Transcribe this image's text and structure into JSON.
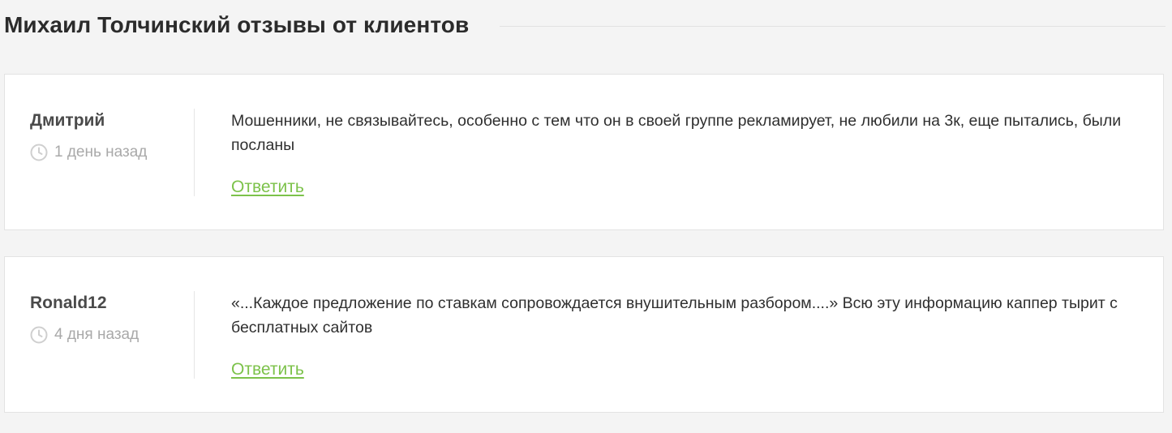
{
  "page": {
    "title": "Михаил Толчинский отзывы от клиентов"
  },
  "reviews": [
    {
      "author": "Дмитрий",
      "date": "1 день назад",
      "text": "Мошенники, не связывайтесь, особенно с тем что он в своей группе рекламирует, не любили на 3к, еще пытались, были посланы",
      "reply_label": "Ответить"
    },
    {
      "author": "Ronald12",
      "date": "4 дня назад",
      "text": "«...Каждое предложение по ставкам сопровождается внушительным разбором....» Всю эту информацию каппер тырит с бесплатных сайтов",
      "reply_label": "Ответить"
    }
  ],
  "icons": {
    "date_icon": "clock-icon"
  },
  "colors": {
    "background": "#f4f4f4",
    "card": "#ffffff",
    "link": "#7cc24a",
    "muted": "#a9a9a9"
  }
}
